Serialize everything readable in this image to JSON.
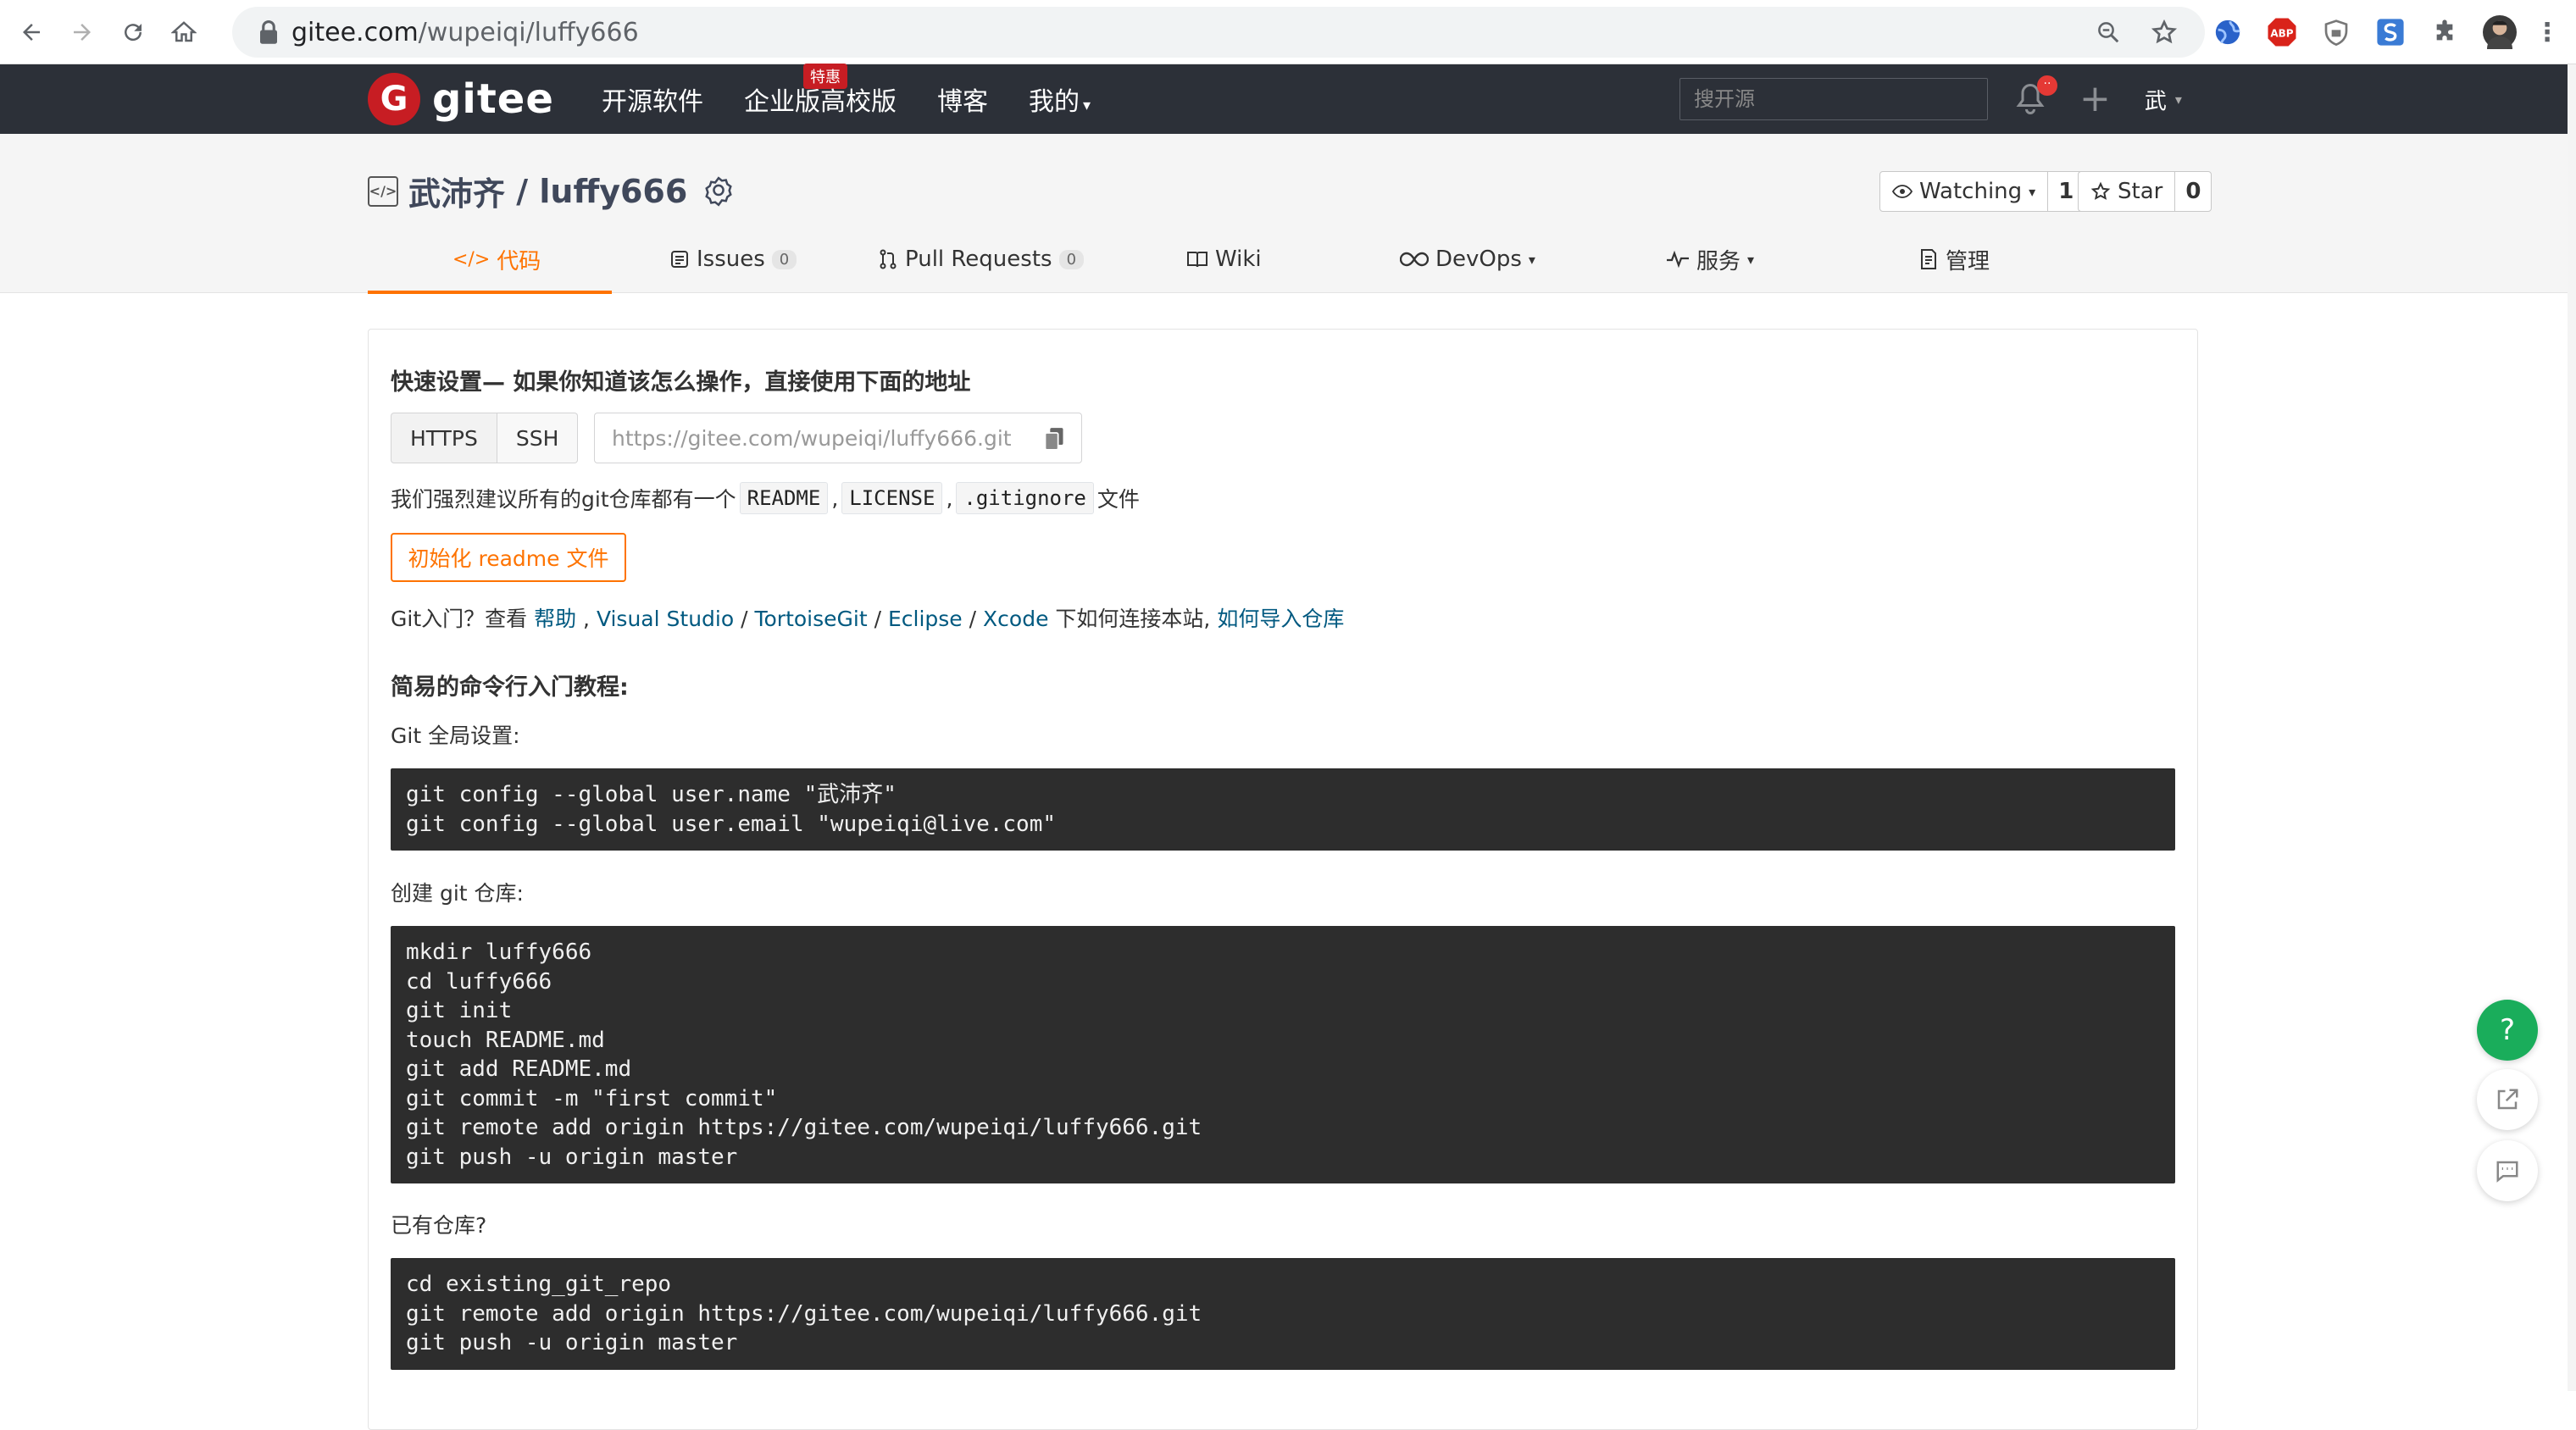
{
  "browser": {
    "url_host": "gitee.com",
    "url_path": "/wupeiqi/luffy666",
    "extensions": [
      {
        "icon": "globe-extension-icon",
        "color": "#2a62c9"
      },
      {
        "icon": "abp-extension-icon",
        "label": "ABP",
        "color": "#d9231a"
      },
      {
        "icon": "shield-extension-icon",
        "color": "#777777"
      },
      {
        "icon": "s-extension-icon",
        "color": "#3a7bd5"
      },
      {
        "icon": "puzzle-extension-icon",
        "color": "#5f6368"
      }
    ]
  },
  "header": {
    "logo_text": "gitee",
    "nav": {
      "open_source": "开源软件",
      "enterprise": "企业版",
      "enterprise_badge": "特惠",
      "education": "高校版",
      "blog": "博客",
      "mine": "我的"
    },
    "search_placeholder": "搜开源",
    "notification_badge": "··",
    "user_initial": "武"
  },
  "project": {
    "owner": "武沛齐",
    "separator": " / ",
    "name": "luffy666",
    "watch_label": "Watching",
    "watch_count": "1",
    "star_label": "Star",
    "star_count": "0",
    "tabs": {
      "code": "代码",
      "issues": "Issues",
      "issues_count": "0",
      "pulls": "Pull Requests",
      "pulls_count": "0",
      "wiki": "Wiki",
      "devops": "DevOps",
      "services": "服务",
      "manage": "管理"
    }
  },
  "quick_setup": {
    "title": "快速设置— 如果你知道该怎么操作，直接使用下面的地址",
    "https": "HTTPS",
    "ssh": "SSH",
    "repo_url": "https://gitee.com/wupeiqi/luffy666.git",
    "recommend_prefix": "我们强烈建议所有的git仓库都有一个",
    "readme": "README",
    "license": "LICENSE",
    "gitignore": ".gitignore",
    "recommend_suffix": "文件",
    "init_button": "初始化 readme 文件",
    "git_help_prefix": "Git入门？查看",
    "link_help": "帮助",
    "link_vs": "Visual Studio",
    "link_tortoise": "TortoiseGit",
    "link_eclipse": "Eclipse",
    "link_xcode": "Xcode",
    "git_help_middle": "下如何连接本站,",
    "link_import": "如何导入仓库"
  },
  "tutorial": {
    "title": "简易的命令行入门教程:",
    "global_label": "Git 全局设置:",
    "global_code": "git config --global user.name \"武沛齐\"\ngit config --global user.email \"wupeiqi@live.com\"",
    "create_label": "创建 git 仓库:",
    "create_code": "mkdir luffy666\ncd luffy666\ngit init\ntouch README.md\ngit add README.md\ngit commit -m \"first commit\"\ngit remote add origin https://gitee.com/wupeiqi/luffy666.git\ngit push -u origin master",
    "existing_label": "已有仓库?",
    "existing_code": "cd existing_git_repo\ngit remote add origin https://gitee.com/wupeiqi/luffy666.git\ngit push -u origin master"
  },
  "floating": {
    "help": "?"
  }
}
